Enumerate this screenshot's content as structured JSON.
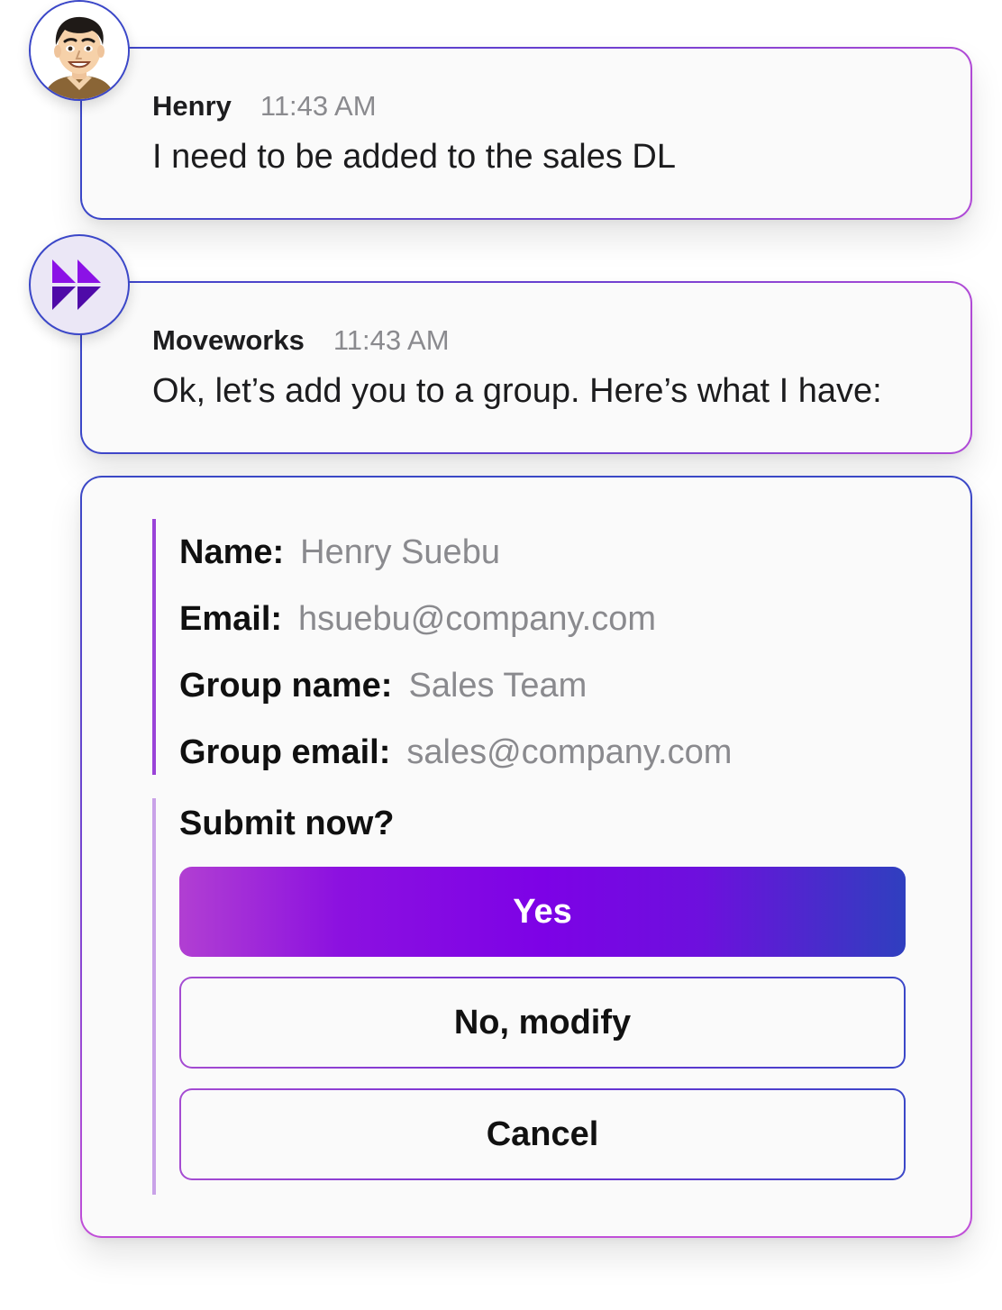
{
  "colors": {
    "border_gradient_start": "#3b47c8",
    "border_gradient_end": "#b04ad6",
    "primary_button_start": "#b13fd2",
    "primary_button_mid": "#7d02e6",
    "primary_button_end": "#2f3fbf",
    "brand_purple": "#6a0bd6",
    "muted_text": "#8a8a8e"
  },
  "messages": [
    {
      "sender": "Henry",
      "time": "11:43 AM",
      "text": "I need to be added to the sales DL",
      "avatar_icon": "user-avatar-icon"
    },
    {
      "sender": "Moveworks",
      "time": "11:43 AM",
      "text": "Ok, let’s add you to a group. Here’s what I have:",
      "avatar_icon": "moveworks-logo-icon"
    }
  ],
  "form": {
    "fields": [
      {
        "label": "Name:",
        "value": "Henry Suebu"
      },
      {
        "label": "Email:",
        "value": "hsuebu@company.com"
      },
      {
        "label": "Group name:",
        "value": "Sales Team"
      },
      {
        "label": "Group email:",
        "value": "sales@company.com"
      }
    ],
    "prompt": "Submit now?",
    "buttons": {
      "yes": "Yes",
      "modify": "No, modify",
      "cancel": "Cancel"
    }
  }
}
